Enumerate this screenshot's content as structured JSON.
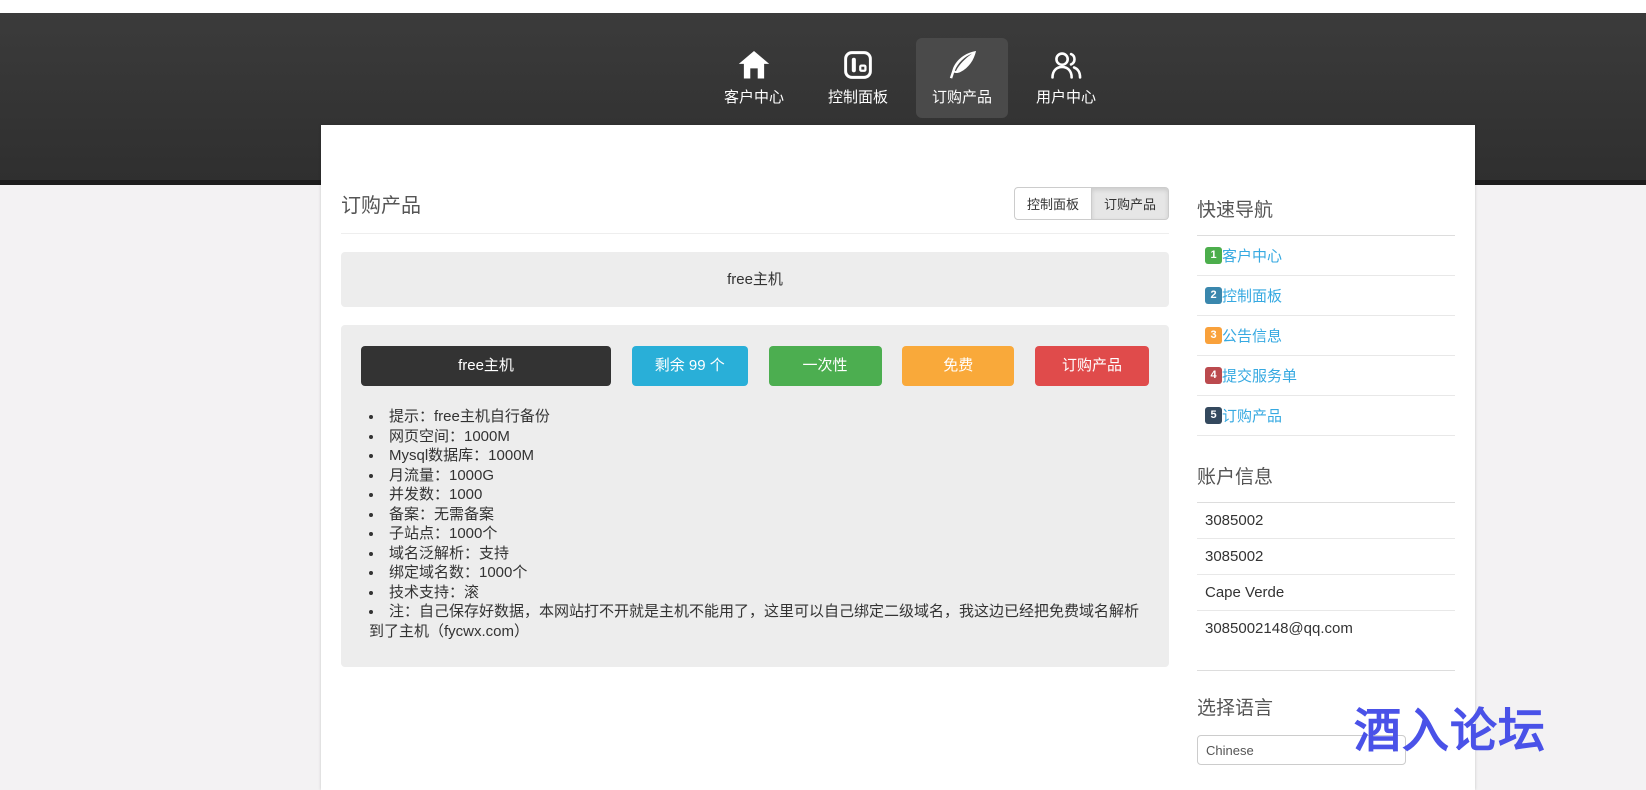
{
  "nav": {
    "items": [
      {
        "label": "客户中心",
        "icon": "home-icon",
        "active": false
      },
      {
        "label": "控制面板",
        "icon": "dashboard-icon",
        "active": false
      },
      {
        "label": "订购产品",
        "icon": "quill-icon",
        "active": true
      },
      {
        "label": "用户中心",
        "icon": "users-icon",
        "active": false
      }
    ]
  },
  "main": {
    "page_title": "订购产品",
    "header_buttons": [
      {
        "label": "控制面板",
        "active": false
      },
      {
        "label": "订购产品",
        "active": true
      }
    ],
    "group_title": "free主机",
    "product": {
      "name": "free主机",
      "name_bg": "#333333",
      "stock_label": "剩余 99 个",
      "stock_color": "#29AFD8",
      "cycle_label": "一次性",
      "cycle_color": "#4CAE50",
      "price_label": "免费",
      "price_color": "#F9A93A",
      "order_label": "订购产品",
      "order_color": "#E04B4B",
      "features": [
        "提示：free主机自行备份",
        "网页空间：1000M",
        "Mysql数据库：1000M",
        "月流量：1000G",
        "并发数：1000",
        "备案：无需备案",
        "子站点：1000个",
        "域名泛解析：支持",
        "绑定域名数：1000个",
        "技术支持：滚",
        "注：自己保存好数据，本网站打不开就是主机不能用了，这里可以自己绑定二级域名，我这边已经把免费域名解析到了主机（fycwx.com）"
      ]
    }
  },
  "sidebar": {
    "quick_nav": {
      "title": "快速导航",
      "items": [
        {
          "num": "1",
          "label": "客户中心",
          "color": "#4CAE4C"
        },
        {
          "num": "2",
          "label": "控制面板",
          "color": "#3A87AD"
        },
        {
          "num": "3",
          "label": "公告信息",
          "color": "#F9A13B"
        },
        {
          "num": "4",
          "label": "提交服务单",
          "color": "#BB4A4E"
        },
        {
          "num": "5",
          "label": "订购产品",
          "color": "#34495E"
        }
      ]
    },
    "account": {
      "title": "账户信息",
      "rows": [
        "3085002",
        "3085002",
        "Cape Verde",
        "3085002148@qq.com"
      ]
    },
    "language": {
      "title": "选择语言",
      "selected": "Chinese"
    }
  },
  "watermark": {
    "text": "酒入论坛",
    "color": "#4A52E8"
  }
}
